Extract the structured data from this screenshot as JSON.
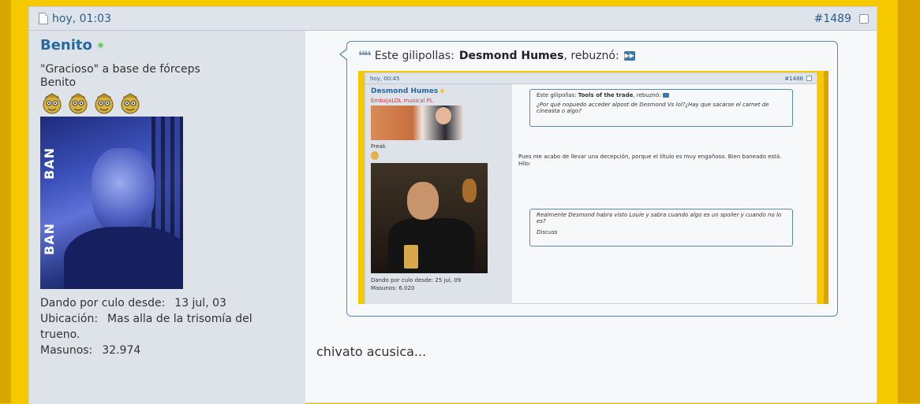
{
  "post": {
    "timestamp": "hoy, 01:03",
    "number": "#1489"
  },
  "author": {
    "username": "Benito",
    "usertitle": "\"Gracioso\" a base de fórceps",
    "rank": "Benito",
    "avatar_text": [
      "BAN",
      "BAN"
    ],
    "info": [
      {
        "label": "Dando por culo desde:",
        "value": "13 jul, 03"
      },
      {
        "label": "Ubicación:",
        "value": "Mas alla de la trisomía del trueno."
      },
      {
        "label": "Masunos:",
        "value": "32.974"
      }
    ]
  },
  "quote": {
    "prefix": "Este gilipollas:",
    "author": "Desmond Humes",
    "suffix": ", rebuznó:"
  },
  "embedded": {
    "timestamp": "hoy, 00:45",
    "number": "#1486",
    "username": "Desmond Humes",
    "usertitle": "EmbajaLOL musical PL",
    "rank": "Freak",
    "info": [
      {
        "label": "Dando por culo desde:",
        "value": "25 jul, 09"
      },
      {
        "label": "Masunos:",
        "value": "6.020"
      }
    ],
    "quote1": {
      "prefix": "Este gilipollas:",
      "author": "Tools of the trade",
      "suffix": ", rebuznó:",
      "text": "¿Por qué nopuedo acceder alpost de Desmond Vs lol?¿Hay que sacarse el carnet de cineasta o algo?"
    },
    "body": "Pues me acabo de llevar una decepción, porque el título es muy engañoso. Bien baneado está.",
    "body2": "Hilo:",
    "quote2": {
      "text": "Realmente Desmond habra visto Louie y sabra cuando algo es un spoiler y cuando no lo es?",
      "text2": "Discuss"
    }
  },
  "message": "chivato acusica...",
  "colors": {
    "frame": "#f6c800",
    "link": "#2569a0",
    "sidebar": "#dde3e9",
    "quote_border": "#5b88b3"
  },
  "icons": [
    "document-icon",
    "checkbox-icon",
    "online-status-icon",
    "rank-star-icon",
    "quote-marks-icon",
    "goto-post-icon"
  ]
}
